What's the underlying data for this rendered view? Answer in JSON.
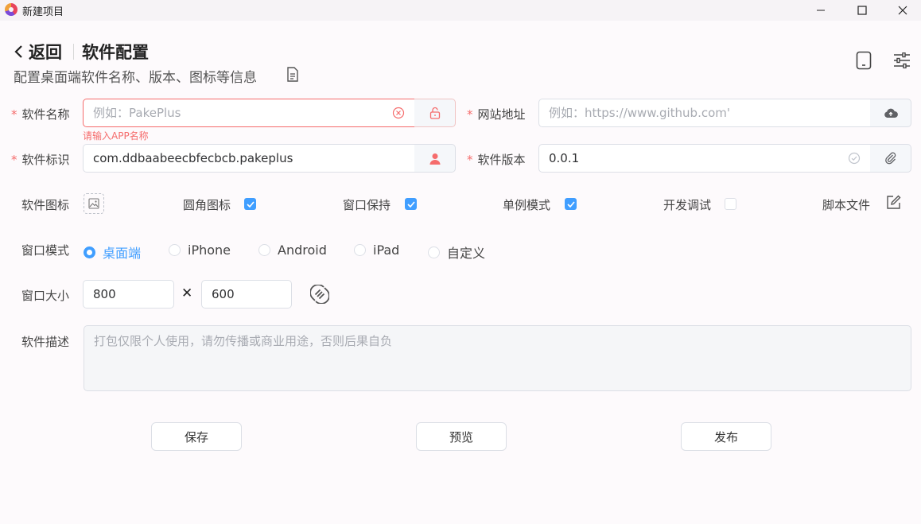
{
  "window": {
    "title": "新建项目",
    "icons": [
      "minimize-icon",
      "maximize-icon",
      "close-icon"
    ]
  },
  "header": {
    "back_label": "返回",
    "title": "软件配置",
    "subtitle": "配置桌面端软件名称、版本、图标等信息",
    "right_icons": [
      "tablet-icon",
      "sliders-icon"
    ]
  },
  "form": {
    "app_name": {
      "label": "软件名称",
      "required": true,
      "value": "",
      "placeholder": "例如：PakePlus",
      "error": "请输入APP名称"
    },
    "website": {
      "label": "网站地址",
      "required": true,
      "value": "",
      "placeholder": "例如：https://www.github.com'"
    },
    "app_id": {
      "label": "软件标识",
      "required": true,
      "value": "com.ddbaabeecbfecbcb.pakeplus"
    },
    "version": {
      "label": "软件版本",
      "required": true,
      "value": "0.0.1"
    },
    "options": {
      "icon_label": "软件图标",
      "rounded_icon": {
        "label": "圆角图标",
        "checked": true
      },
      "keep_window": {
        "label": "窗口保持",
        "checked": true
      },
      "single_instance": {
        "label": "单例模式",
        "checked": true
      },
      "debug": {
        "label": "开发调试",
        "checked": false
      },
      "script_file": {
        "label": "脚本文件"
      }
    },
    "window_mode": {
      "label": "窗口模式",
      "options": [
        "桌面端",
        "iPhone",
        "Android",
        "iPad",
        "自定义"
      ],
      "selected": "桌面端"
    },
    "window_size": {
      "label": "窗口大小",
      "width": "800",
      "height": "600",
      "separator": "✕"
    },
    "description": {
      "label": "软件描述",
      "value": "",
      "placeholder": "打包仅限个人使用，请勿传播或商业用途，否则后果自负"
    }
  },
  "actions": {
    "save": "保存",
    "preview": "预览",
    "publish": "发布"
  },
  "colors": {
    "primary": "#409eff",
    "danger": "#f56c6c",
    "background": "#fdfafc"
  }
}
